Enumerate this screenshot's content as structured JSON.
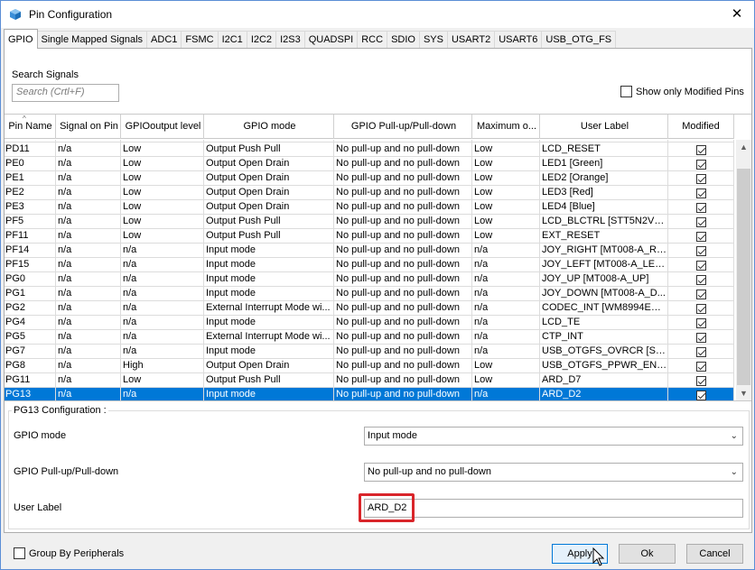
{
  "window": {
    "title": "Pin Configuration",
    "close_glyph": "✕",
    "icon": "app-cube-icon"
  },
  "tabs": [
    {
      "label": "GPIO",
      "active": true
    },
    {
      "label": "Single Mapped Signals"
    },
    {
      "label": "ADC1"
    },
    {
      "label": "FSMC"
    },
    {
      "label": "I2C1"
    },
    {
      "label": "I2C2"
    },
    {
      "label": "I2S3"
    },
    {
      "label": "QUADSPI"
    },
    {
      "label": "RCC"
    },
    {
      "label": "SDIO"
    },
    {
      "label": "SYS"
    },
    {
      "label": "USART2"
    },
    {
      "label": "USART6"
    },
    {
      "label": "USB_OTG_FS"
    }
  ],
  "search": {
    "label": "Search Signals",
    "placeholder": "Search (Crtl+F)"
  },
  "show_modified": {
    "label": "Show only Modified Pins",
    "checked": false
  },
  "table": {
    "columns": [
      "Pin Name",
      "Signal on Pin",
      "GPIOoutput level",
      "GPIO mode",
      "GPIO Pull-up/Pull-down",
      "Maximum o...",
      "User Label",
      "Modified"
    ],
    "rows": [
      {
        "pin": "PD11",
        "signal": "n/a",
        "level": "Low",
        "mode": "Output Push Pull",
        "pull": "No pull-up and no pull-down",
        "max": "Low",
        "label": "LCD_RESET",
        "modified": true
      },
      {
        "pin": "PE0",
        "signal": "n/a",
        "level": "Low",
        "mode": "Output Open Drain",
        "pull": "No pull-up and no pull-down",
        "max": "Low",
        "label": "LED1 [Green]",
        "modified": true
      },
      {
        "pin": "PE1",
        "signal": "n/a",
        "level": "Low",
        "mode": "Output Open Drain",
        "pull": "No pull-up and no pull-down",
        "max": "Low",
        "label": "LED2 [Orange]",
        "modified": true
      },
      {
        "pin": "PE2",
        "signal": "n/a",
        "level": "Low",
        "mode": "Output Open Drain",
        "pull": "No pull-up and no pull-down",
        "max": "Low",
        "label": "LED3 [Red]",
        "modified": true
      },
      {
        "pin": "PE3",
        "signal": "n/a",
        "level": "Low",
        "mode": "Output Open Drain",
        "pull": "No pull-up and no pull-down",
        "max": "Low",
        "label": "LED4 [Blue]",
        "modified": true
      },
      {
        "pin": "PF5",
        "signal": "n/a",
        "level": "Low",
        "mode": "Output Push Pull",
        "pull": "No pull-up and no pull-down",
        "max": "Low",
        "label": "LCD_BLCTRL [STT5N2VH5...",
        "modified": true
      },
      {
        "pin": "PF11",
        "signal": "n/a",
        "level": "Low",
        "mode": "Output Push Pull",
        "pull": "No pull-up and no pull-down",
        "max": "Low",
        "label": "EXT_RESET",
        "modified": true
      },
      {
        "pin": "PF14",
        "signal": "n/a",
        "level": "n/a",
        "mode": "Input mode",
        "pull": "No pull-up and no pull-down",
        "max": "n/a",
        "label": "JOY_RIGHT [MT008-A_RI...",
        "modified": true
      },
      {
        "pin": "PF15",
        "signal": "n/a",
        "level": "n/a",
        "mode": "Input mode",
        "pull": "No pull-up and no pull-down",
        "max": "n/a",
        "label": "JOY_LEFT [MT008-A_LEFT]",
        "modified": true
      },
      {
        "pin": "PG0",
        "signal": "n/a",
        "level": "n/a",
        "mode": "Input mode",
        "pull": "No pull-up and no pull-down",
        "max": "n/a",
        "label": "JOY_UP [MT008-A_UP]",
        "modified": true
      },
      {
        "pin": "PG1",
        "signal": "n/a",
        "level": "n/a",
        "mode": "Input mode",
        "pull": "No pull-up and no pull-down",
        "max": "n/a",
        "label": "JOY_DOWN [MT008-A_D...",
        "modified": true
      },
      {
        "pin": "PG2",
        "signal": "n/a",
        "level": "n/a",
        "mode": "External Interrupt Mode wi...",
        "pull": "No pull-up and no pull-down",
        "max": "n/a",
        "label": "CODEC_INT [WM8994ECS...",
        "modified": true
      },
      {
        "pin": "PG4",
        "signal": "n/a",
        "level": "n/a",
        "mode": "Input mode",
        "pull": "No pull-up and no pull-down",
        "max": "n/a",
        "label": "LCD_TE",
        "modified": true
      },
      {
        "pin": "PG5",
        "signal": "n/a",
        "level": "n/a",
        "mode": "External Interrupt Mode wi...",
        "pull": "No pull-up and no pull-down",
        "max": "n/a",
        "label": "CTP_INT",
        "modified": true
      },
      {
        "pin": "PG7",
        "signal": "n/a",
        "level": "n/a",
        "mode": "Input mode",
        "pull": "No pull-up and no pull-down",
        "max": "n/a",
        "label": "USB_OTGFS_OVRCR [STM...",
        "modified": true
      },
      {
        "pin": "PG8",
        "signal": "n/a",
        "level": "High",
        "mode": "Output Open Drain",
        "pull": "No pull-up and no pull-down",
        "max": "Low",
        "label": "USB_OTGFS_PPWR_EN [S...",
        "modified": true
      },
      {
        "pin": "PG11",
        "signal": "n/a",
        "level": "Low",
        "mode": "Output Push Pull",
        "pull": "No pull-up and no pull-down",
        "max": "Low",
        "label": "ARD_D7",
        "modified": true
      },
      {
        "pin": "PG13",
        "signal": "n/a",
        "level": "n/a",
        "mode": "Input mode",
        "pull": "No pull-up and no pull-down",
        "max": "n/a",
        "label": "ARD_D2",
        "modified": true,
        "selected": true
      }
    ]
  },
  "config": {
    "title": "PG13 Configuration :",
    "gpio_mode_label": "GPIO mode",
    "gpio_mode_value": "Input mode",
    "pull_label": "GPIO Pull-up/Pull-down",
    "pull_value": "No pull-up and no pull-down",
    "user_label_label": "User Label",
    "user_label_value": "ARD_D2",
    "highlight_color": "#d9252a"
  },
  "footer": {
    "group_by_label": "Group By Peripherals",
    "group_by_checked": false,
    "apply_label": "Apply",
    "ok_label": "Ok",
    "cancel_label": "Cancel"
  },
  "colors": {
    "selection": "#0078d7",
    "window_border": "#5b8ed6"
  }
}
